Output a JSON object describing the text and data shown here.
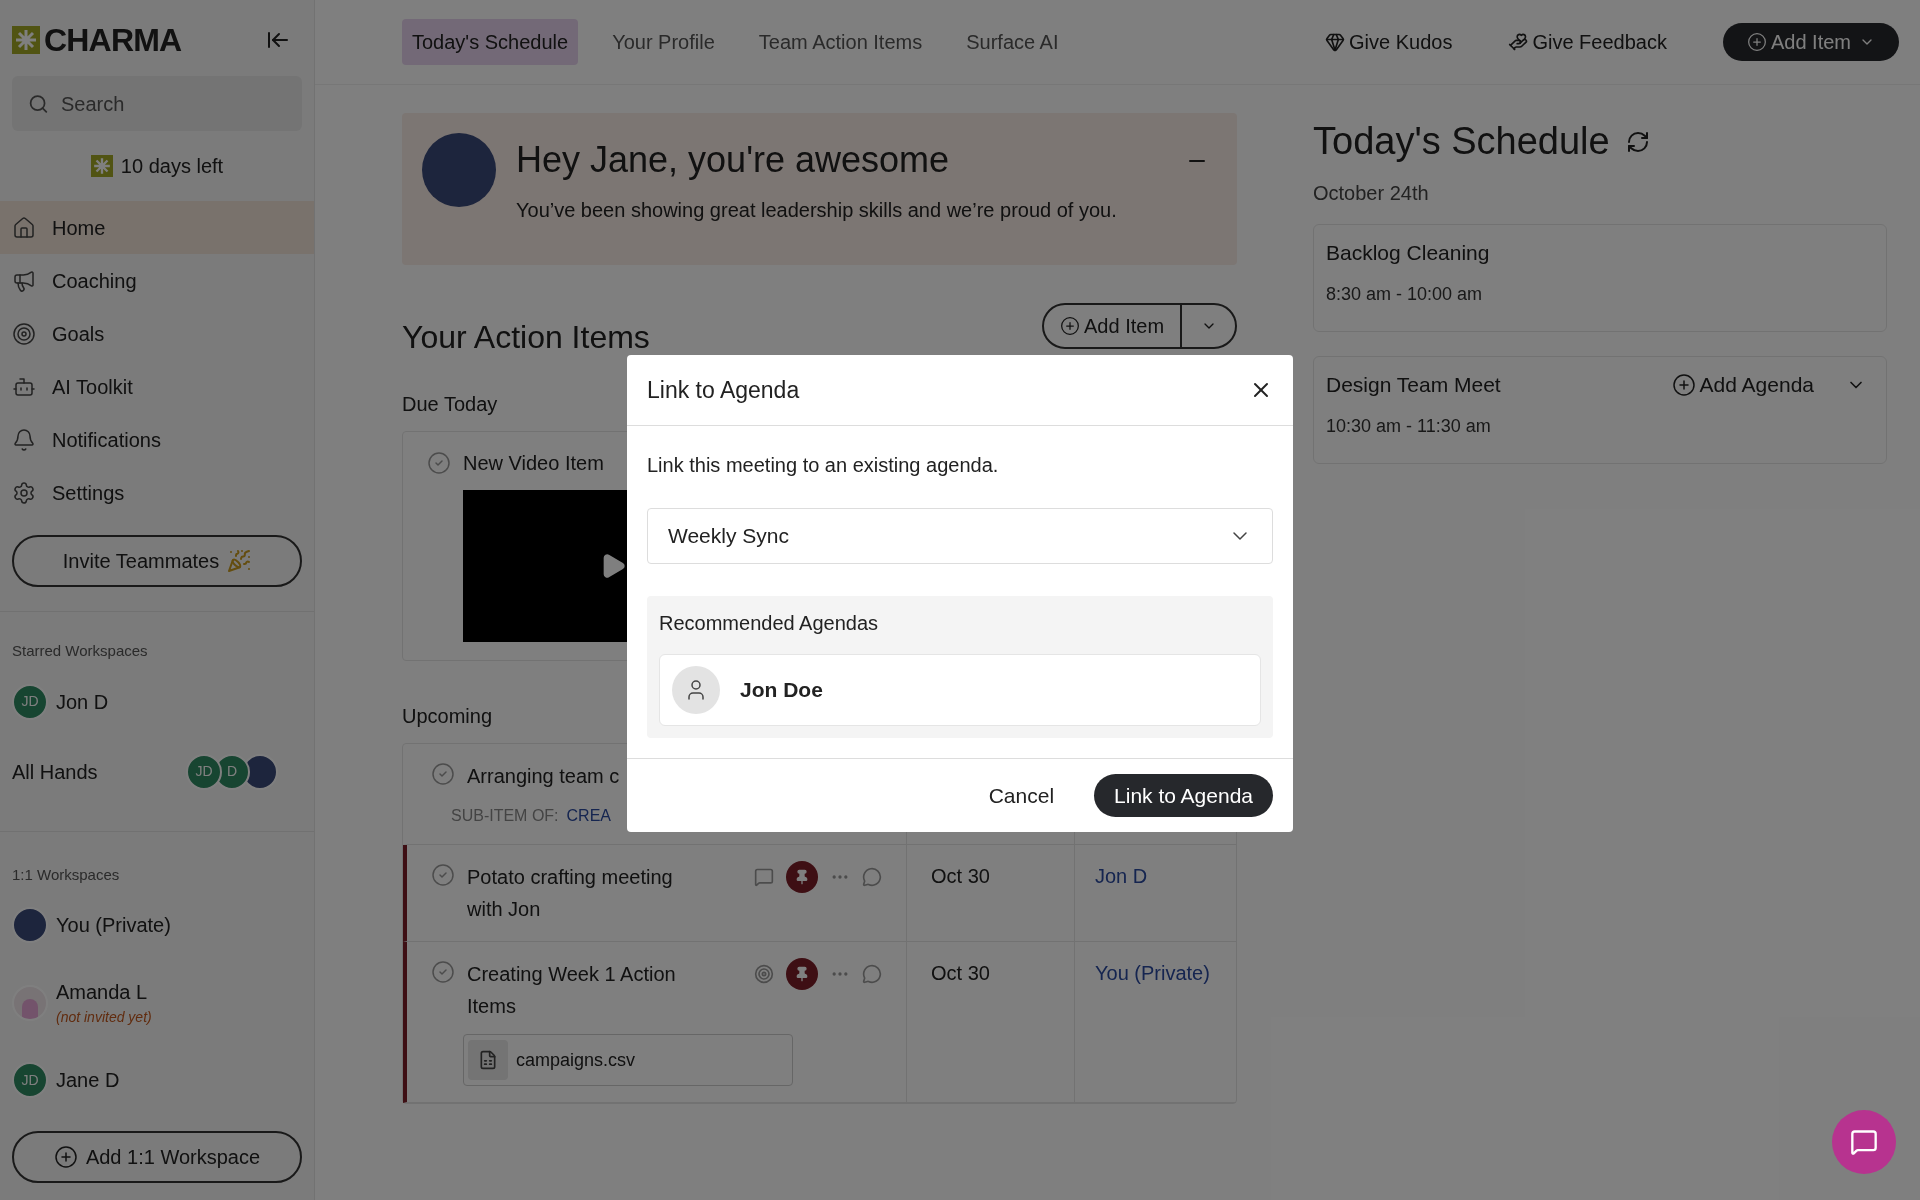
{
  "sidebar": {
    "logo": "CHARMA",
    "search": {
      "placeholder": "Search"
    },
    "trial": "10 days left",
    "nav": [
      {
        "label": "Home",
        "selected": true
      },
      {
        "label": "Coaching",
        "selected": false
      },
      {
        "label": "Goals",
        "selected": false
      },
      {
        "label": "AI Toolkit",
        "selected": false
      },
      {
        "label": "Notifications",
        "selected": false
      },
      {
        "label": "Settings",
        "selected": false
      }
    ],
    "invite_button": "Invite Teammates",
    "starred": {
      "heading": "Starred Workspaces",
      "items": [
        {
          "name": "Jon D",
          "avatars": [
            {
              "kind": "initials",
              "text": "JD"
            }
          ]
        },
        {
          "name": "All Hands",
          "avatars": [
            {
              "kind": "initials",
              "text": "JD"
            },
            {
              "kind": "initials",
              "text": "D"
            },
            {
              "kind": "photo"
            }
          ]
        }
      ]
    },
    "one_on_one": {
      "heading": "1:1 Workspaces",
      "items": [
        {
          "name": "You (Private)",
          "avatars": [
            {
              "kind": "photo"
            }
          ]
        },
        {
          "name": "Amanda L",
          "note": "(not invited yet)",
          "avatars": [
            {
              "kind": "illustration"
            }
          ]
        },
        {
          "name": "Jane D",
          "avatars": [
            {
              "kind": "initials",
              "text": "JD"
            }
          ]
        }
      ]
    },
    "add_workspace_button": "Add 1:1 Workspace"
  },
  "top_nav": {
    "tabs": [
      {
        "label": "Today's Schedule",
        "selected": true
      },
      {
        "label": "Your Profile",
        "selected": false
      },
      {
        "label": "Team Action Items",
        "selected": false
      },
      {
        "label": "Surface AI",
        "selected": false
      }
    ],
    "actions": [
      "Give Kudos",
      "Give Feedback"
    ],
    "add_button": "Add Item"
  },
  "greeting": {
    "title": "Hey Jane, you're awesome",
    "message": "You’ve been showing great leadership skills and we’re proud of you."
  },
  "action_items": {
    "title": "Your Action Items",
    "add_button": "Add Item",
    "due_today": {
      "heading": "Due Today",
      "items": [
        {
          "title": "New Video Item"
        }
      ]
    },
    "upcoming": {
      "heading": "Upcoming",
      "rows": [
        {
          "title": "Arranging team c",
          "sub_item_label": "SUB-ITEM OF:",
          "sub_item_link": "CREA",
          "flagged": false
        },
        {
          "title": "Potato crafting meeting with Jon",
          "date": "Oct 30",
          "owner": "Jon D",
          "flagged": true
        },
        {
          "title": "Creating Week 1 Action Items",
          "date": "Oct 30",
          "owner": "You (Private)",
          "attachment": "campaigns.csv",
          "flagged": true
        }
      ]
    }
  },
  "schedule": {
    "title": "Today's Schedule",
    "date": "October 24th",
    "events": [
      {
        "title": "Backlog Cleaning",
        "time": "8:30 am - 10:00 am"
      },
      {
        "title": "Design Team Meet",
        "time": "10:30 am - 11:30 am",
        "add_agenda": "Add Agenda"
      }
    ]
  },
  "modal": {
    "title": "Link to Agenda",
    "description": "Link this meeting to an existing agenda.",
    "select": {
      "value": "Weekly Sync"
    },
    "recommended": {
      "heading": "Recommended Agendas",
      "items": [
        {
          "name": "Jon Doe"
        }
      ]
    },
    "cancel": "Cancel",
    "confirm": "Link to Agenda"
  }
}
